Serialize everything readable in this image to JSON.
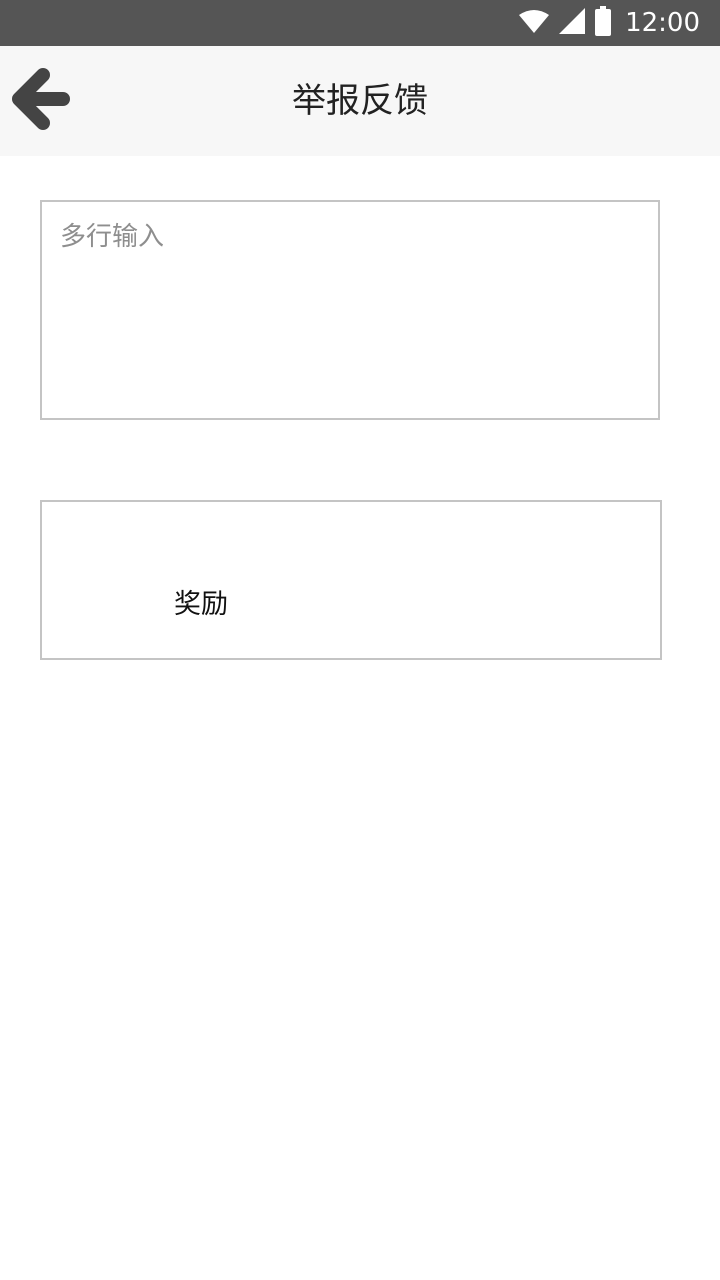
{
  "status_bar": {
    "time": "12:00",
    "icons": [
      "wifi-icon",
      "cell-signal-icon",
      "battery-icon"
    ]
  },
  "header": {
    "title": "举报反馈",
    "back_icon": "arrow-left-icon"
  },
  "feedback": {
    "value": "",
    "placeholder": "多行输入"
  },
  "reward": {
    "label": "奖励"
  },
  "colors": {
    "status_bar_bg": "#555555",
    "app_bar_bg": "#f7f7f7",
    "border": "#c4c4c4",
    "icon": "#444444"
  }
}
